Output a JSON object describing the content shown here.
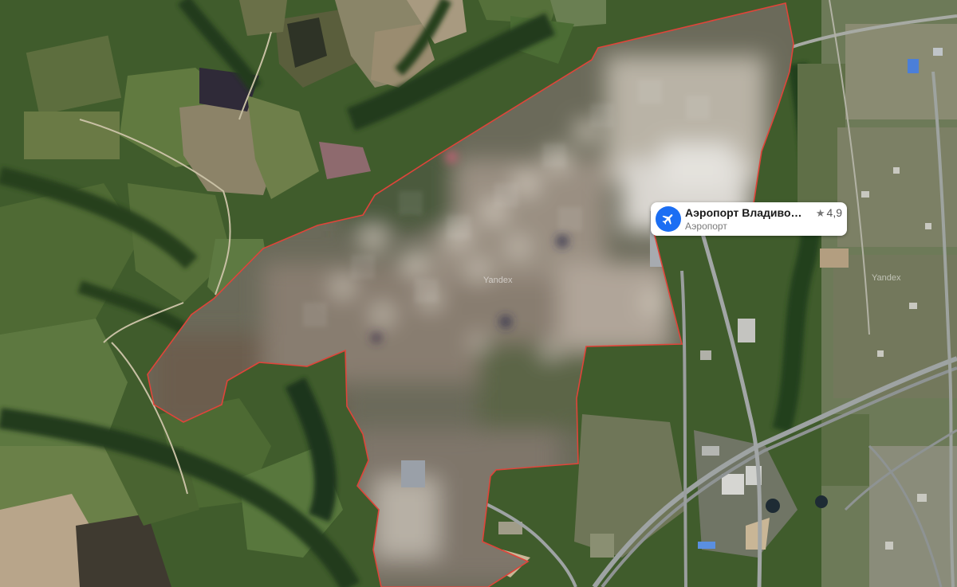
{
  "map": {
    "watermark": "Yandex",
    "boundary_color": "#e0443a"
  },
  "poi": {
    "name": "Аэропорт Владиво…",
    "category": "Аэропорт",
    "rating": "4,9",
    "icon": "airplane-icon",
    "accent_color": "#1b6ef3"
  }
}
